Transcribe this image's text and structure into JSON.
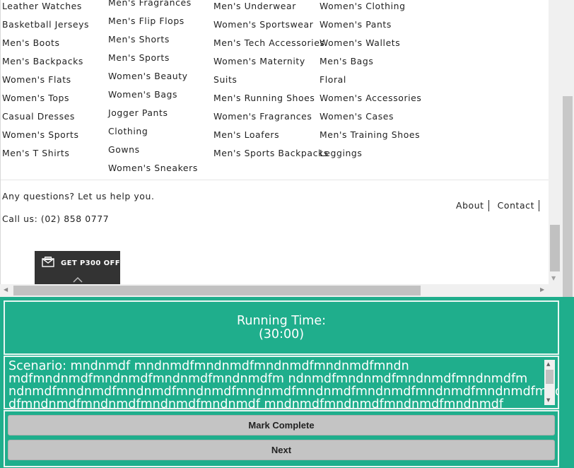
{
  "categories": {
    "col0": [
      "Leather Watches",
      "Basketball Jerseys",
      "Men's Boots",
      "Men's Backpacks",
      "Women's Flats",
      "Women's Tops",
      "Casual Dresses",
      "Women's Sports",
      "Men's T Shirts"
    ],
    "col1": [
      "Men's Fragrances",
      "Men's Flip Flops",
      "Men's Shorts",
      "Men's Sports",
      "Women's Beauty",
      "Women's Bags",
      "Jogger Pants",
      "Clothing",
      "Gowns",
      "Women's Sneakers"
    ],
    "col2": [
      "Men's Underwear",
      "Women's Sportswear",
      "Men's Tech Accessories",
      "Women's Maternity",
      "Suits",
      "Men's Running Shoes",
      "Women's Fragrances",
      "Men's Loafers",
      "Men's Sports Backpacks"
    ],
    "col3": [
      "Women's Clothing",
      "Women's Pants",
      "Women's Wallets",
      "Men's Bags",
      "Floral",
      "Women's Accessories",
      "Women's Cases",
      "Men's Training Shoes",
      "Leggings"
    ]
  },
  "footer": {
    "questions": "Any questions? Let us help you.",
    "call_us": "Call us: (02) 858 0777",
    "links": [
      "About",
      "Contact"
    ]
  },
  "promo": {
    "label": "GET P300 OFF",
    "icon": "envelope-icon"
  },
  "task": {
    "running_time_label": "Running Time:",
    "running_time_value": "(30:00)",
    "scenario": "Scenario: mndnmdf mndnmdfmndnmdfmndnmdfmndnmdfmndn mdfmndnmdfmndnmdfmndnmdfmndnmdfm ndnmdfmndnmdfmndnmdfmndnmdfm ndnmdfmndnmdfmndnmdfmndnmdfmndnmdfmndnmdfmndnmdfmndnmdfmndnmdfmndnmdf dfmndnmdfmndnmdfmndnmdfmndnmdf mndnmdfmndnmdfmndnmdfmndnmdf",
    "mark_complete_label": "Mark Complete",
    "next_label": "Next"
  },
  "colors": {
    "panel_bg": "#1fae8c",
    "promo_bg": "#333333",
    "button_bg": "#c4c4c4"
  }
}
